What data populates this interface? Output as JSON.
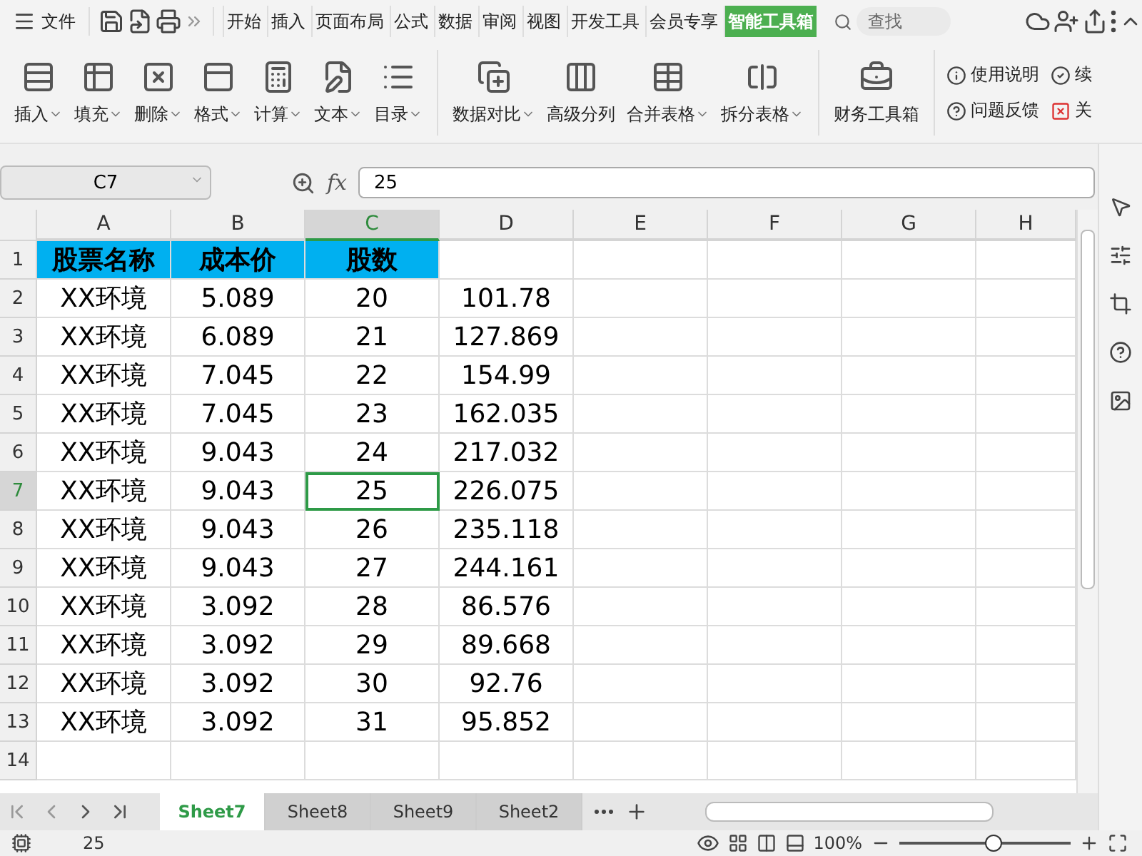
{
  "menu": {
    "file": "文件",
    "tabs": [
      {
        "label": "开始",
        "selected": false
      },
      {
        "label": "插入",
        "selected": false
      },
      {
        "label": "页面布局",
        "selected": false
      },
      {
        "label": "公式",
        "selected": false
      },
      {
        "label": "数据",
        "selected": false
      },
      {
        "label": "审阅",
        "selected": false
      },
      {
        "label": "视图",
        "selected": false
      },
      {
        "label": "开发工具",
        "selected": false
      },
      {
        "label": "会员专享",
        "selected": false
      },
      {
        "label": "智能工具箱",
        "selected": true
      }
    ],
    "search": {
      "placeholder": "查找"
    }
  },
  "ribbon": {
    "groups": [
      [
        {
          "label": "插入",
          "dropdown": true
        },
        {
          "label": "填充",
          "dropdown": true
        },
        {
          "label": "删除",
          "dropdown": true
        },
        {
          "label": "格式",
          "dropdown": true
        },
        {
          "label": "计算",
          "dropdown": true
        },
        {
          "label": "文本",
          "dropdown": true
        },
        {
          "label": "目录",
          "dropdown": true
        }
      ],
      [
        {
          "label": "数据对比",
          "dropdown": true
        },
        {
          "label": "高级分列",
          "dropdown": false
        },
        {
          "label": "合并表格",
          "dropdown": true
        },
        {
          "label": "拆分表格",
          "dropdown": true
        }
      ],
      [
        {
          "label": "财务工具箱",
          "dropdown": false
        }
      ]
    ],
    "links": [
      "使用说明",
      "问题反馈",
      "续",
      "关"
    ]
  },
  "formula_bar": {
    "cell": "C7",
    "fx_label": "fx",
    "value": "25"
  },
  "table": {
    "columns": [
      {
        "label": "A",
        "selected": false
      },
      {
        "label": "B",
        "selected": false
      },
      {
        "label": "C",
        "selected": true
      },
      {
        "label": "D",
        "selected": false
      },
      {
        "label": "E",
        "selected": false
      },
      {
        "label": "F",
        "selected": false
      },
      {
        "label": "G",
        "selected": false
      },
      {
        "label": "H",
        "selected": false
      }
    ],
    "rows": [
      {
        "number": "1",
        "kind": "header",
        "selected": false,
        "cells": [
          "股票名称",
          "成本价",
          "股数"
        ]
      },
      {
        "number": "2",
        "kind": "data",
        "selected": false,
        "cells": [
          "XX环境",
          "5.089",
          "20",
          "101.78"
        ]
      },
      {
        "number": "3",
        "kind": "data",
        "selected": false,
        "cells": [
          "XX环境",
          "6.089",
          "21",
          "127.869"
        ]
      },
      {
        "number": "4",
        "kind": "data",
        "selected": false,
        "cells": [
          "XX环境",
          "7.045",
          "22",
          "154.99"
        ]
      },
      {
        "number": "5",
        "kind": "data",
        "selected": false,
        "cells": [
          "XX环境",
          "7.045",
          "23",
          "162.035"
        ]
      },
      {
        "number": "6",
        "kind": "data",
        "selected": false,
        "cells": [
          "XX环境",
          "9.043",
          "24",
          "217.032"
        ]
      },
      {
        "number": "7",
        "kind": "data",
        "selected": true,
        "cells": [
          "XX环境",
          "9.043",
          "25",
          "226.075"
        ]
      },
      {
        "number": "8",
        "kind": "data",
        "selected": false,
        "cells": [
          "XX环境",
          "9.043",
          "26",
          "235.118"
        ]
      },
      {
        "number": "9",
        "kind": "data",
        "selected": false,
        "cells": [
          "XX环境",
          "9.043",
          "27",
          "244.161"
        ]
      },
      {
        "number": "10",
        "kind": "data",
        "selected": false,
        "cells": [
          "XX环境",
          "3.092",
          "28",
          "86.576"
        ]
      },
      {
        "number": "11",
        "kind": "data",
        "selected": false,
        "cells": [
          "XX环境",
          "3.092",
          "29",
          "89.668"
        ]
      },
      {
        "number": "12",
        "kind": "data",
        "selected": false,
        "cells": [
          "XX环境",
          "3.092",
          "30",
          "92.76"
        ]
      },
      {
        "number": "13",
        "kind": "data",
        "selected": false,
        "cells": [
          "XX环境",
          "3.092",
          "31",
          "95.852"
        ]
      },
      {
        "number": "14",
        "kind": "data",
        "selected": false
      }
    ]
  },
  "sheets": [
    {
      "label": "Sheet7",
      "selected": true
    },
    {
      "label": "Sheet8",
      "selected": false
    },
    {
      "label": "Sheet9",
      "selected": false
    },
    {
      "label": "Sheet2",
      "selected": false
    }
  ],
  "status_bar": {
    "value": "25",
    "zoom": "100%",
    "zoom_slider": {
      "level": 0.55
    }
  }
}
